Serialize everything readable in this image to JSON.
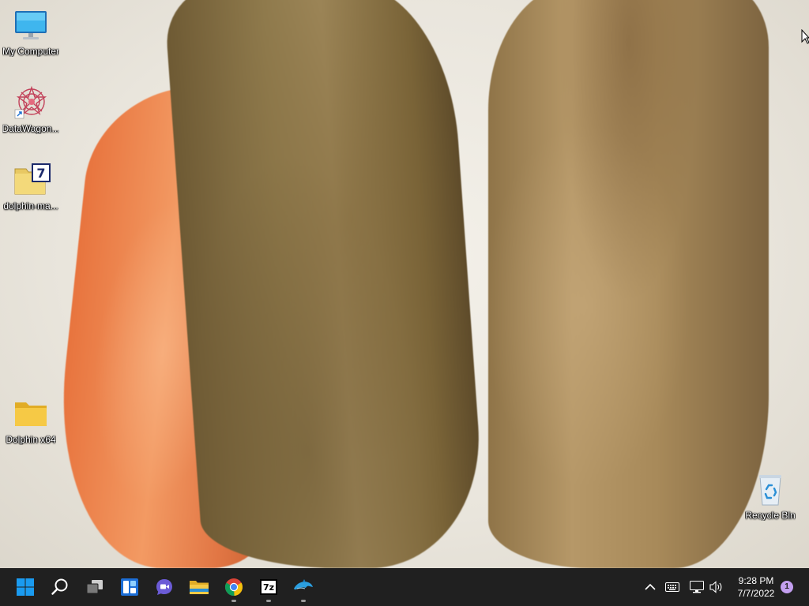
{
  "desktop": {
    "icons": [
      {
        "label": "My Computer",
        "icon": "monitor-icon"
      },
      {
        "label": "DataWagon...",
        "icon": "datawagon-shortcut-icon"
      },
      {
        "label": "dolphin-ma...",
        "icon": "7zip-archive-icon"
      },
      {
        "label": "Dolphin x64",
        "icon": "folder-icon"
      },
      {
        "label": "Recycle Bin",
        "icon": "recycle-bin-icon"
      }
    ]
  },
  "taskbar": {
    "buttons": [
      {
        "name": "Start",
        "icon": "windows-start-icon"
      },
      {
        "name": "Search",
        "icon": "search-icon"
      },
      {
        "name": "Task View",
        "icon": "task-view-icon"
      },
      {
        "name": "Widgets",
        "icon": "widgets-icon"
      },
      {
        "name": "Chat",
        "icon": "chat-icon"
      },
      {
        "name": "File Explorer",
        "icon": "file-explorer-icon"
      },
      {
        "name": "Google Chrome",
        "icon": "chrome-icon"
      },
      {
        "name": "7-Zip",
        "icon": "7zip-icon",
        "text": "7z"
      },
      {
        "name": "Dolphin",
        "icon": "dolphin-icon"
      }
    ],
    "tray": {
      "clock_time": "9:28 PM",
      "clock_date": "7/7/2022",
      "notification_count": "1"
    }
  },
  "colors": {
    "taskbar_bg": "#202020",
    "start_blue": "#1a9bf0",
    "folder_yellow": "#f6c945",
    "notification_purple": "#c49ff0"
  }
}
